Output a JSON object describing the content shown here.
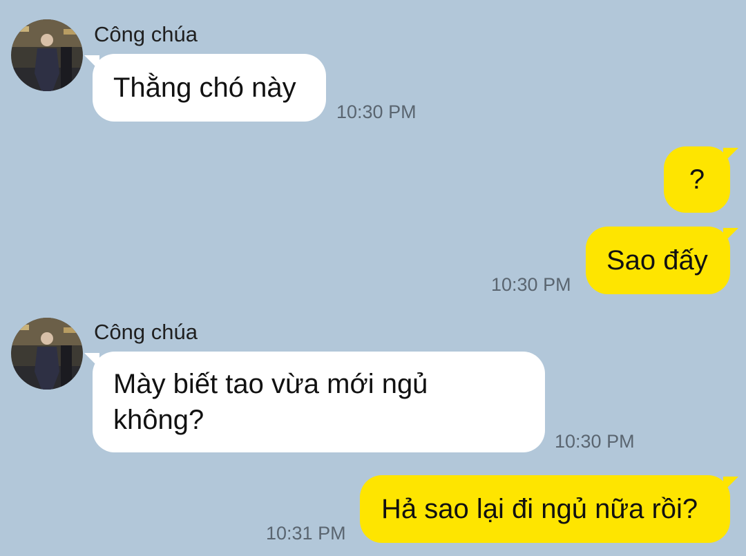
{
  "chat": {
    "messages": [
      {
        "sender": "Công chúa",
        "text": "Thằng chó này",
        "time": "10:30 PM",
        "direction": "incoming"
      },
      {
        "text": "?",
        "direction": "outgoing"
      },
      {
        "text": "Sao đấy",
        "time": "10:30 PM",
        "direction": "outgoing"
      },
      {
        "sender": "Công chúa",
        "text": "Mày biết tao vừa mới ngủ không?",
        "time": "10:30 PM",
        "direction": "incoming"
      },
      {
        "text": "Hả sao lại đi ngủ nữa rồi?",
        "time": "10:31 PM",
        "direction": "outgoing"
      }
    ]
  },
  "colors": {
    "background": "#b2c7d9",
    "incoming_bubble": "#ffffff",
    "outgoing_bubble": "#fee500"
  }
}
